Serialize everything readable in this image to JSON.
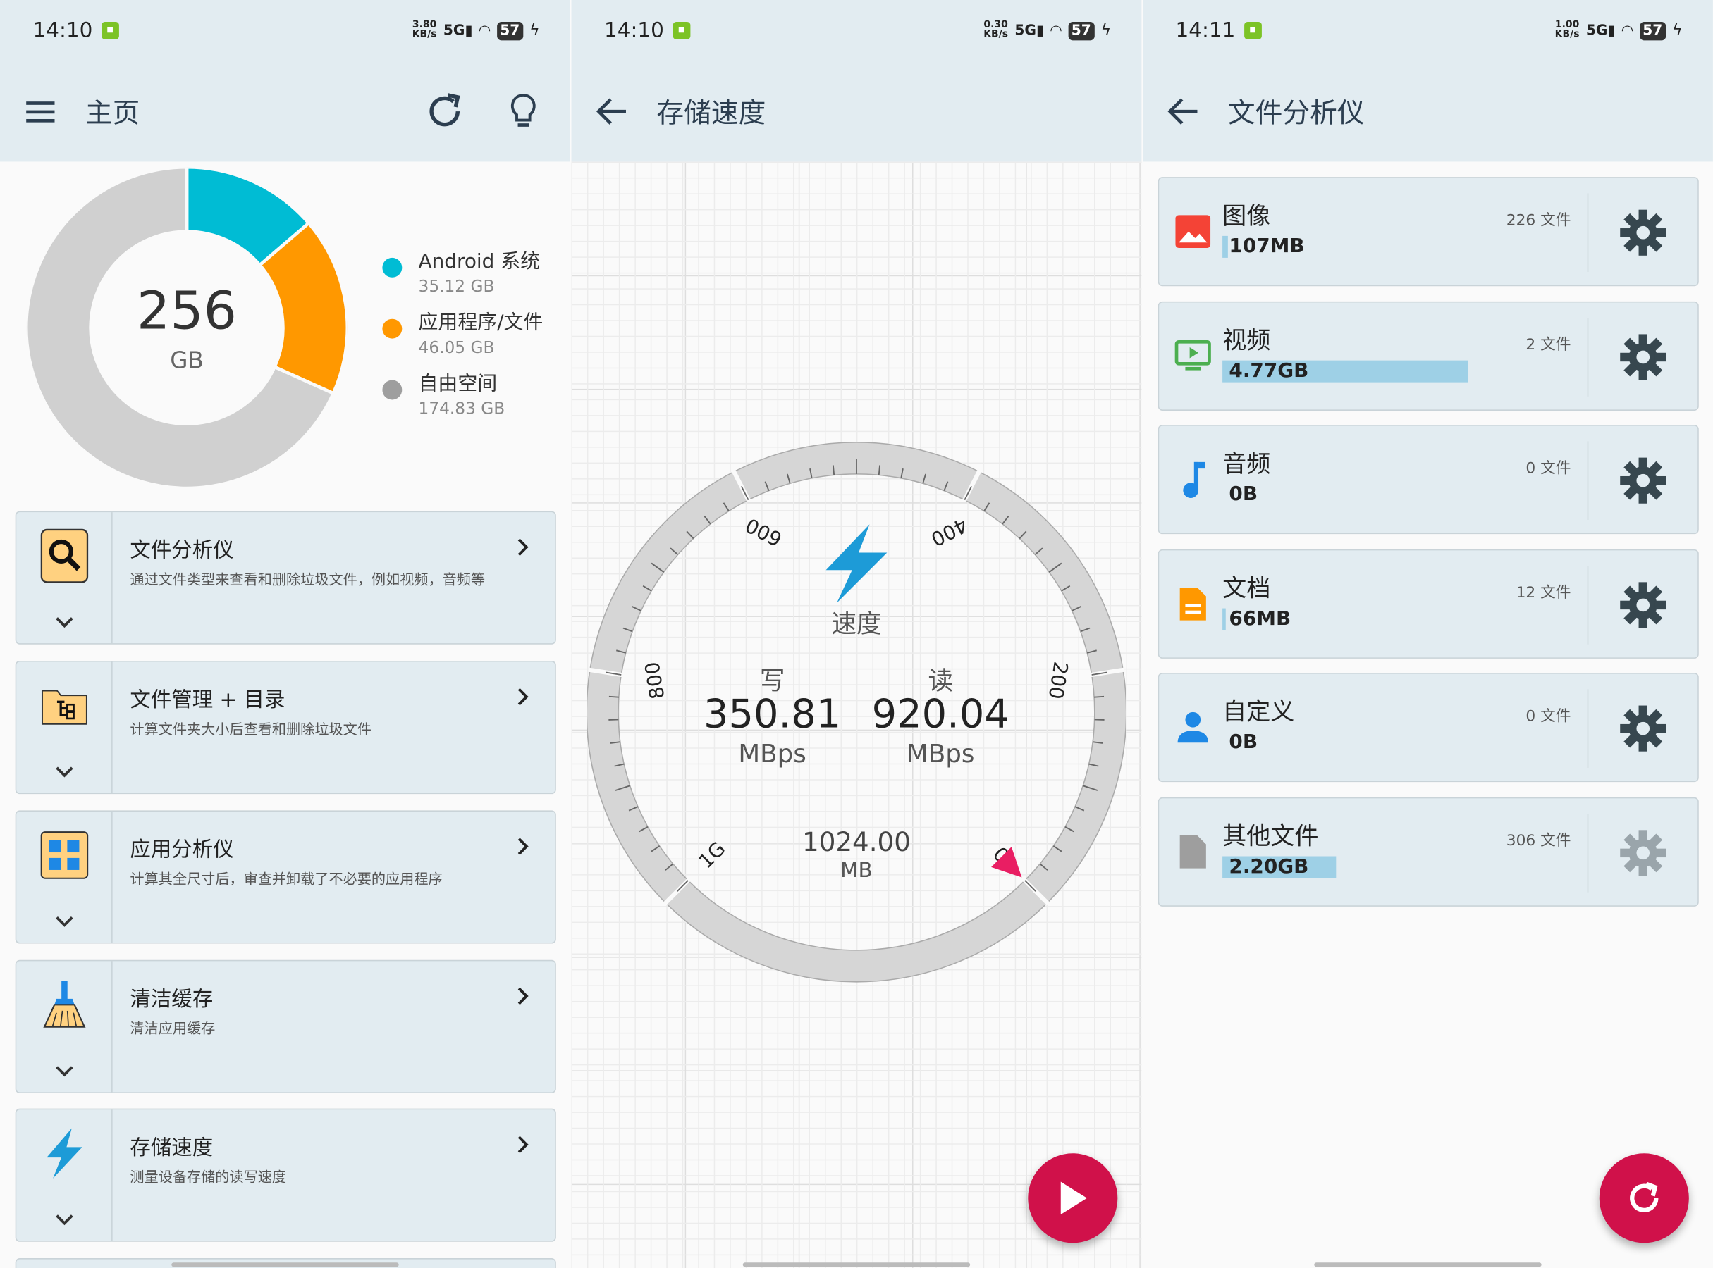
{
  "home": {
    "status": {
      "time": "14:10",
      "speed_top": "3.80",
      "speed_unit": "KB/s",
      "network": "5G",
      "battery": "57"
    },
    "title": "主页",
    "storage_total": "256",
    "storage_unit": "GB",
    "storage_chart": {
      "type": "pie",
      "series": [
        {
          "name": "Android 系统",
          "value_gb": 35.12,
          "label": "35.12 GB",
          "color": "#00bcd4"
        },
        {
          "name": "应用程序/文件",
          "value_gb": 46.05,
          "label": "46.05 GB",
          "color": "#ff9800"
        },
        {
          "name": "自由空间",
          "value_gb": 174.83,
          "label": "174.83 GB",
          "color": "#d0d0d0"
        }
      ]
    },
    "cards": [
      {
        "title": "文件分析仪",
        "desc": "通过文件类型来查看和删除垃圾文件，例如视频，音频等",
        "icon": "magnifier-icon"
      },
      {
        "title": "文件管理 + 目录",
        "desc": "计算文件夹大小后查看和删除垃圾文件",
        "icon": "folder-tree-icon"
      },
      {
        "title": "应用分析仪",
        "desc": "计算其全尺寸后，审查并卸载了不必要的应用程序",
        "icon": "app-grid-icon"
      },
      {
        "title": "清洁缓存",
        "desc": "清洁应用缓存",
        "icon": "broom-icon"
      },
      {
        "title": "存储速度",
        "desc": "测量设备存储的读写速度",
        "icon": "bolt-icon"
      }
    ]
  },
  "speed": {
    "status": {
      "time": "14:10",
      "speed_top": "0.30",
      "speed_unit": "KB/s",
      "network": "5G",
      "battery": "57"
    },
    "title": "存储速度",
    "gauge_label": "速度",
    "write_label": "写",
    "write_value": "350.81",
    "write_unit": "MBps",
    "read_label": "读",
    "read_value": "920.04",
    "read_unit": "MBps",
    "test_size": "1024.00",
    "test_unit": "MB",
    "ticks": [
      "0",
      "200",
      "400",
      "600",
      "800",
      "1G"
    ],
    "needle_value": 0,
    "accent_color": "#1d9bd7",
    "fab_color": "#d0114a"
  },
  "analyzer": {
    "status": {
      "time": "14:11",
      "speed_top": "1.00",
      "speed_unit": "KB/s",
      "network": "5G",
      "battery": "57"
    },
    "title": "文件分析仪",
    "rows": [
      {
        "name": "图像",
        "size": "107MB",
        "count": "226 文件",
        "bar_fraction": 0.022,
        "icon": "image-icon",
        "color": "#f44336"
      },
      {
        "name": "视频",
        "size": "4.77GB",
        "count": "2 文件",
        "bar_fraction": 1.0,
        "icon": "video-icon",
        "color": "#4caf50"
      },
      {
        "name": "音频",
        "size": "0B",
        "count": "0 文件",
        "bar_fraction": 0.0,
        "icon": "music-note-icon",
        "color": "#1e88e5"
      },
      {
        "name": "文档",
        "size": "66MB",
        "count": "12 文件",
        "bar_fraction": 0.014,
        "icon": "document-icon",
        "color": "#ff9800"
      },
      {
        "name": "自定义",
        "size": "0B",
        "count": "0 文件",
        "bar_fraction": 0.0,
        "icon": "person-icon",
        "color": "#1e88e5"
      },
      {
        "name": "其他文件",
        "size": "2.20GB",
        "count": "306 文件",
        "bar_fraction": 0.46,
        "icon": "file-icon",
        "color": "#9e9e9e"
      }
    ],
    "fab_color": "#d0114a"
  }
}
